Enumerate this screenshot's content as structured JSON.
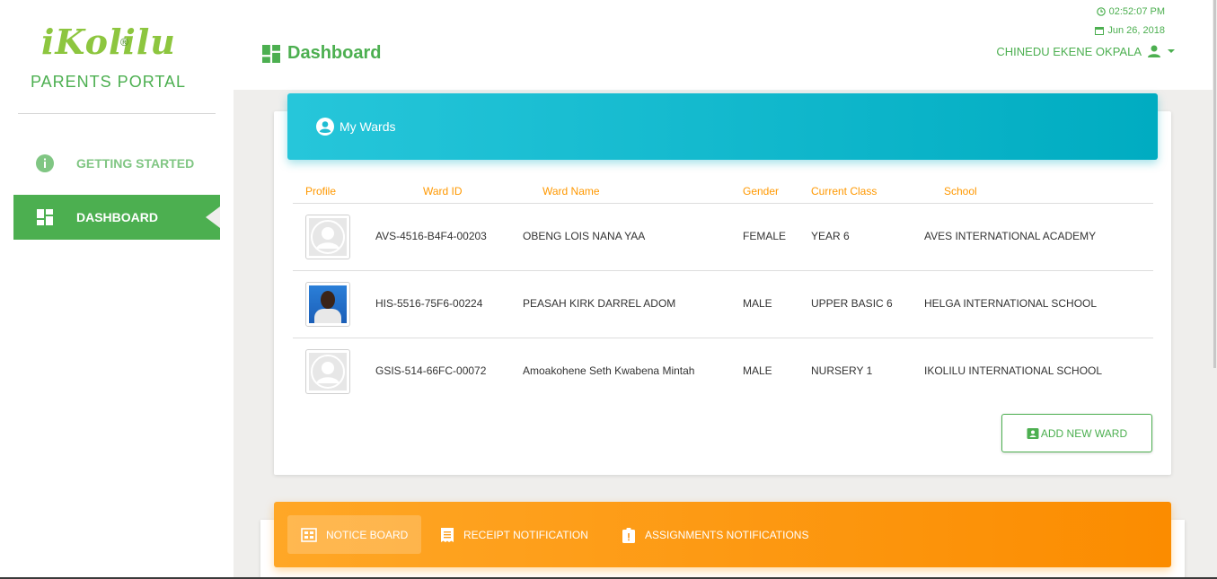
{
  "brand": {
    "logo_text": "iKolilu",
    "registered": "®",
    "portal_name": "PARENTS PORTAL",
    "color": "#4caf50"
  },
  "sidebar": {
    "items": [
      {
        "label": "GETTING STARTED",
        "icon": "info-icon",
        "active": false
      },
      {
        "label": "DASHBOARD",
        "icon": "dashboard-icon",
        "active": true
      }
    ]
  },
  "header": {
    "title": "Dashboard",
    "time": "02:52:07 PM",
    "date": "Jun 26, 2018",
    "user_name": "CHINEDU EKENE OKPALA"
  },
  "wards": {
    "title": "My Wards",
    "columns": [
      "Profile",
      "Ward ID",
      "Ward Name",
      "Gender",
      "Current Class",
      "School"
    ],
    "rows": [
      {
        "ward_id": "AVS-4516-B4F4-00203",
        "name": "OBENG LOIS NANA YAA",
        "gender": "FEMALE",
        "class": "YEAR 6",
        "school": "AVES INTERNATIONAL ACADEMY",
        "photo": "placeholder"
      },
      {
        "ward_id": "HIS-5516-75F6-00224",
        "name": "PEASAH KIRK DARREL ADOM",
        "gender": "MALE",
        "class": "UPPER BASIC 6",
        "school": "HELGA INTERNATIONAL SCHOOL",
        "photo": "student-photo"
      },
      {
        "ward_id": "GSIS-514-66FC-00072",
        "name": "Amoakohene Seth Kwabena Mintah",
        "gender": "MALE",
        "class": "NURSERY 1",
        "school": "IKOLILU INTERNATIONAL SCHOOL",
        "photo": "placeholder"
      }
    ],
    "add_button": "ADD NEW WARD"
  },
  "notifications": {
    "tabs": [
      {
        "label": "NOTICE BOARD",
        "icon": "notice-board-icon",
        "active": true
      },
      {
        "label": "RECEIPT NOTIFICATION",
        "icon": "receipt-icon",
        "active": false
      },
      {
        "label": "ASSIGNMENTS NOTIFICATIONS",
        "icon": "assignment-icon",
        "active": false
      }
    ]
  }
}
